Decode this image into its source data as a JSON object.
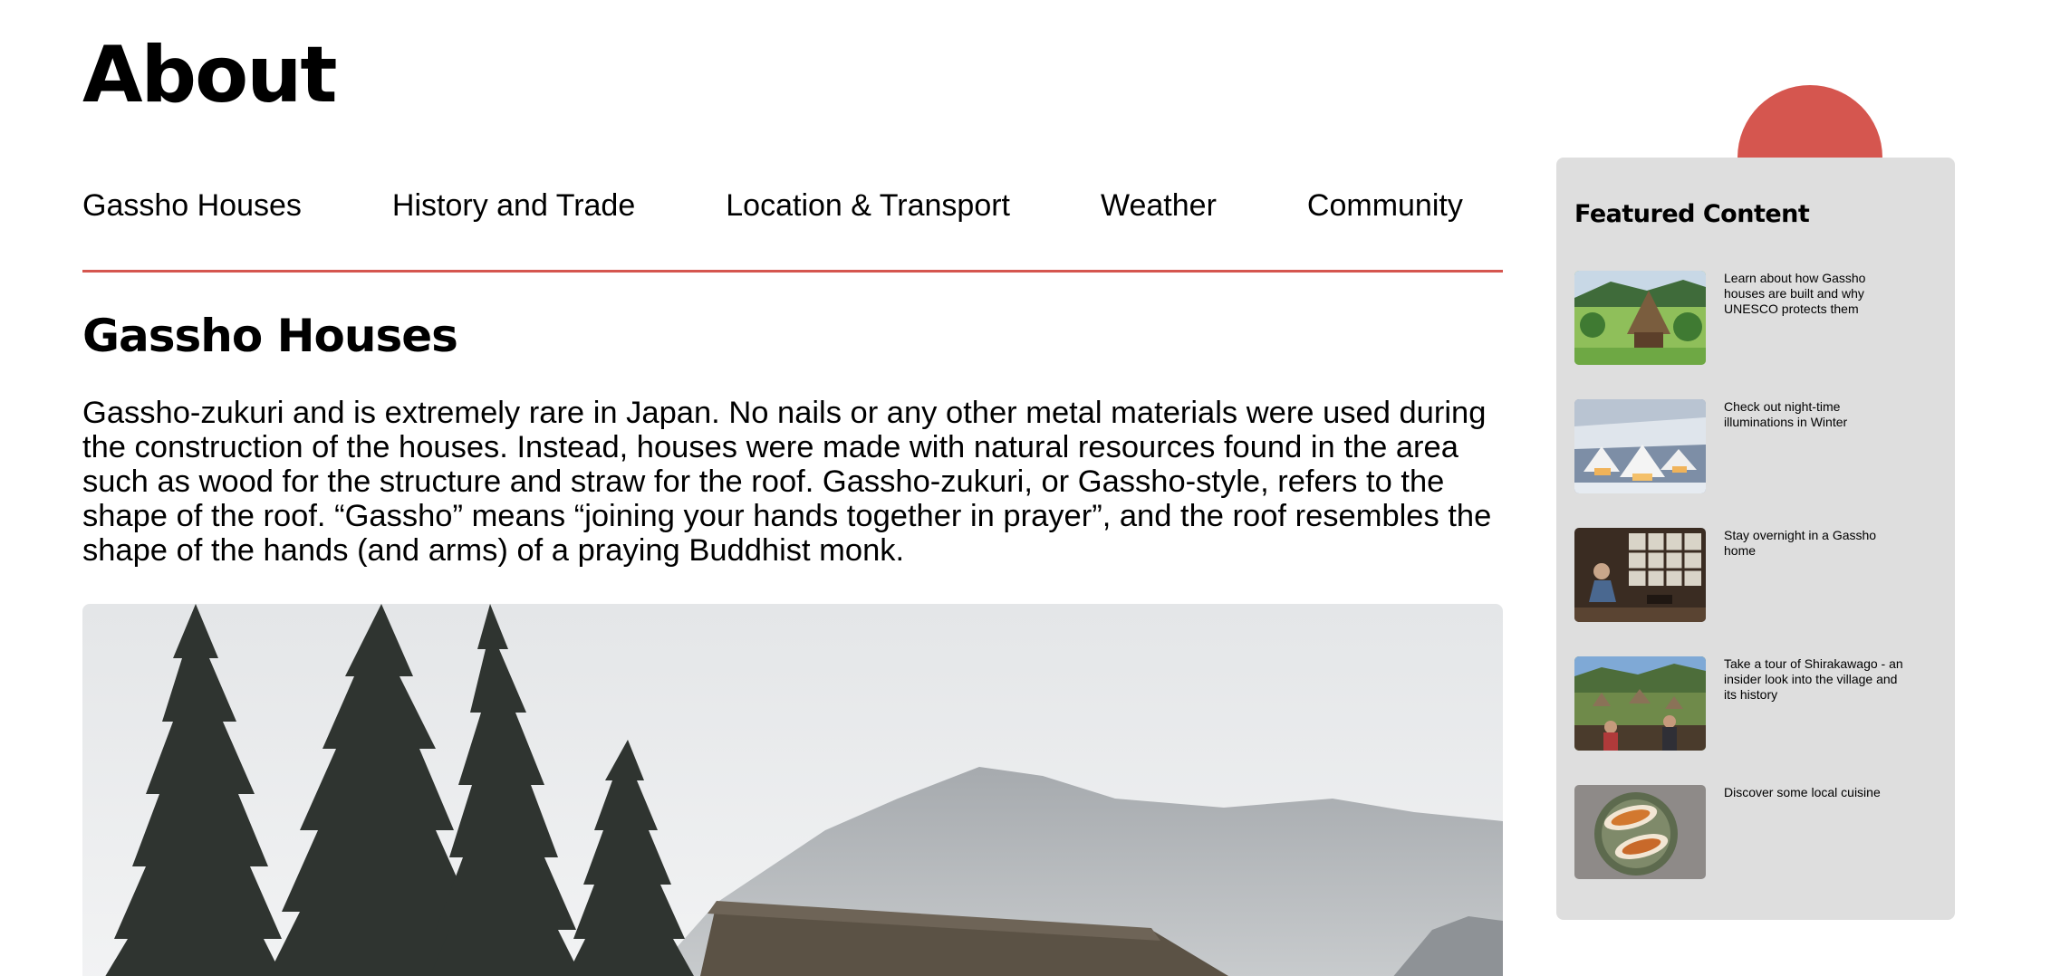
{
  "page": {
    "title": "About"
  },
  "tabs": [
    {
      "label": "Gassho Houses"
    },
    {
      "label": "History and Trade"
    },
    {
      "label": "Location & Transport"
    },
    {
      "label": "Weather"
    },
    {
      "label": "Community"
    }
  ],
  "section": {
    "heading": "Gassho Houses",
    "body": "Gassho-zukuri and is extremely rare in Japan. No nails or any other metal materials were used during the construction of the houses. Instead, houses were made with natural resources found in the area such as wood for the structure and straw for the roof. Gassho-zukuri, or Gassho-style, refers to the shape of the roof. “Gassho” means “joining your hands together in prayer”, and the roof resembles the shape of the hands (and arms) of a praying Buddhist monk."
  },
  "sidebar": {
    "heading": "Featured Content",
    "items": [
      {
        "text": "Learn about how Gassho houses are built and why UNESCO protects them",
        "icon": "gassho-house-summer-photo"
      },
      {
        "text": "Check out night-time illuminations in Winter",
        "icon": "winter-illumination-photo"
      },
      {
        "text": "Stay overnight in a Gassho home",
        "icon": "gassho-interior-photo"
      },
      {
        "text": "Take a tour of Shirakawago - an insider look into the village and its history",
        "icon": "village-tour-photo"
      },
      {
        "text": "Discover some local cuisine",
        "icon": "local-cuisine-photo"
      }
    ]
  },
  "colors": {
    "accent": "#d5564f",
    "sidebar_bg": "#dedede",
    "text": "#000000"
  }
}
